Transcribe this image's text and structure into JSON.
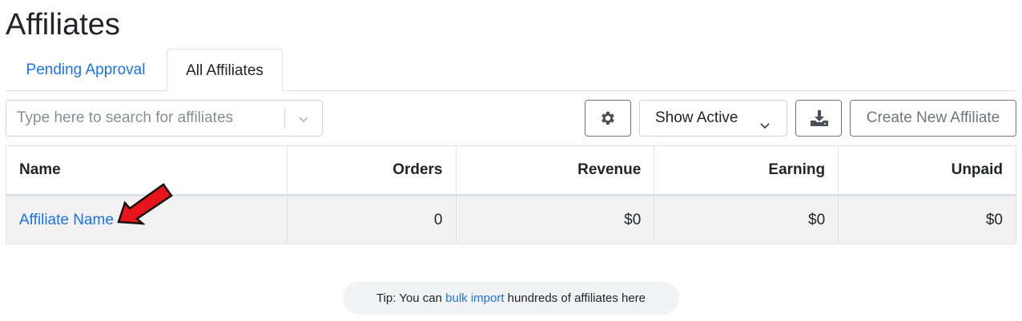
{
  "page": {
    "title": "Affiliates"
  },
  "tabs": [
    {
      "label": "Pending Approval",
      "active": false
    },
    {
      "label": "All Affiliates",
      "active": true
    }
  ],
  "search": {
    "placeholder": "Type here to search for affiliates",
    "value": ""
  },
  "toolbar": {
    "settings_icon": "gear-icon",
    "filter_selected": "Show Active",
    "download_icon": "download-icon",
    "create_label": "Create New Affiliate"
  },
  "table": {
    "columns": [
      "Name",
      "Orders",
      "Revenue",
      "Earning",
      "Unpaid"
    ],
    "rows": [
      {
        "name": "Affiliate Name",
        "orders": "0",
        "revenue": "$0",
        "earning": "$0",
        "unpaid": "$0"
      }
    ]
  },
  "tip": {
    "prefix": "Tip: You can ",
    "link": "bulk import",
    "suffix": " hundreds of affiliates here"
  },
  "colors": {
    "link": "#1a73e8",
    "annotation_arrow": "#e8141c"
  }
}
